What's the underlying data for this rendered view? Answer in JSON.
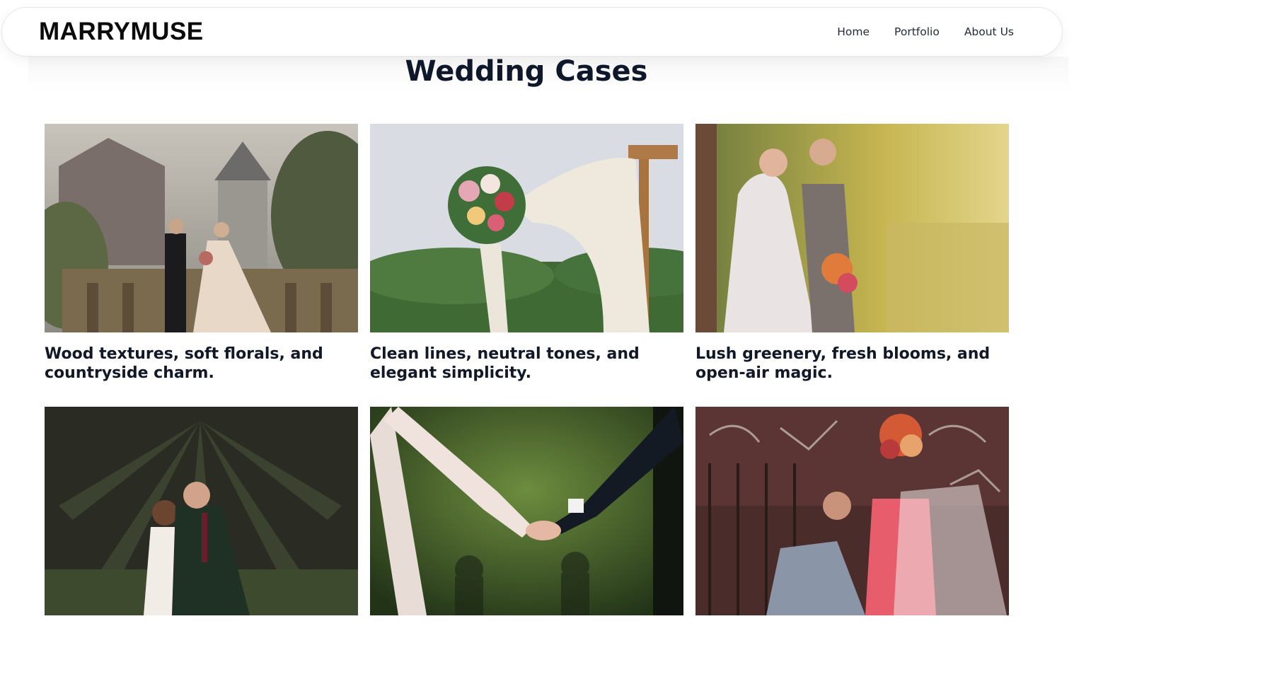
{
  "header": {
    "brand": "MARRYMUSE",
    "nav": [
      {
        "label": "Home"
      },
      {
        "label": "Portfolio"
      },
      {
        "label": "About Us"
      }
    ]
  },
  "main": {
    "title": "Wedding Cases",
    "cards": [
      {
        "caption": "Wood textures, soft florals, and countryside charm.",
        "image_subject": "couple-on-castle-balcony"
      },
      {
        "caption": "Clean lines, neutral tones, and elegant simplicity.",
        "image_subject": "bouquet-on-wooden-arch"
      },
      {
        "caption": "Lush greenery, fresh blooms, and open-air magic.",
        "image_subject": "couple-by-autumn-lake"
      },
      {
        "caption": "",
        "image_subject": "couple-under-palm-trees"
      },
      {
        "caption": "",
        "image_subject": "holding-hands-close-up"
      },
      {
        "caption": "",
        "image_subject": "couple-with-graffiti-wall"
      }
    ]
  },
  "colors": {
    "text": "#111827",
    "title": "#0f172a",
    "nav_border": "#e6e6e6",
    "background": "#ffffff"
  }
}
